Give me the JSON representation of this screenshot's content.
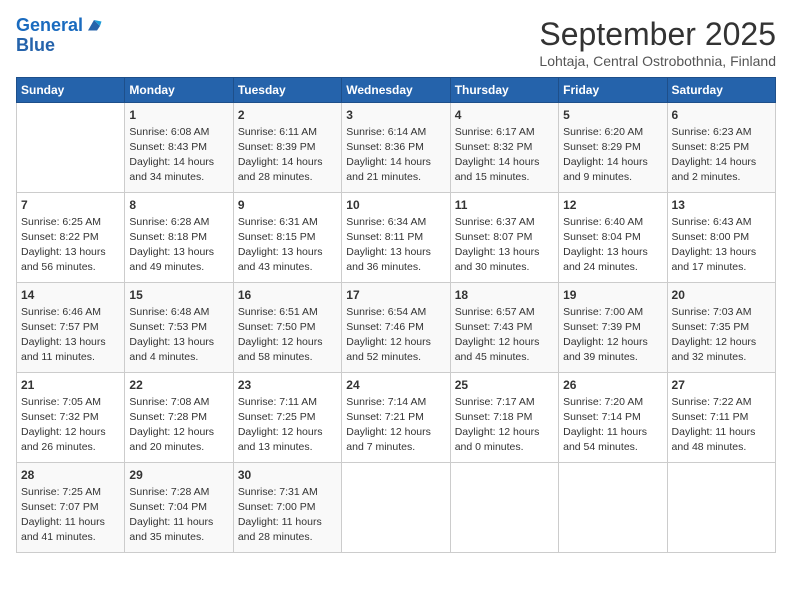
{
  "logo": {
    "line1": "General",
    "line2": "Blue"
  },
  "title": "September 2025",
  "location": "Lohtaja, Central Ostrobothnia, Finland",
  "days_of_week": [
    "Sunday",
    "Monday",
    "Tuesday",
    "Wednesday",
    "Thursday",
    "Friday",
    "Saturday"
  ],
  "weeks": [
    [
      {
        "day": "",
        "info": ""
      },
      {
        "day": "1",
        "info": "Sunrise: 6:08 AM\nSunset: 8:43 PM\nDaylight: 14 hours\nand 34 minutes."
      },
      {
        "day": "2",
        "info": "Sunrise: 6:11 AM\nSunset: 8:39 PM\nDaylight: 14 hours\nand 28 minutes."
      },
      {
        "day": "3",
        "info": "Sunrise: 6:14 AM\nSunset: 8:36 PM\nDaylight: 14 hours\nand 21 minutes."
      },
      {
        "day": "4",
        "info": "Sunrise: 6:17 AM\nSunset: 8:32 PM\nDaylight: 14 hours\nand 15 minutes."
      },
      {
        "day": "5",
        "info": "Sunrise: 6:20 AM\nSunset: 8:29 PM\nDaylight: 14 hours\nand 9 minutes."
      },
      {
        "day": "6",
        "info": "Sunrise: 6:23 AM\nSunset: 8:25 PM\nDaylight: 14 hours\nand 2 minutes."
      }
    ],
    [
      {
        "day": "7",
        "info": "Sunrise: 6:25 AM\nSunset: 8:22 PM\nDaylight: 13 hours\nand 56 minutes."
      },
      {
        "day": "8",
        "info": "Sunrise: 6:28 AM\nSunset: 8:18 PM\nDaylight: 13 hours\nand 49 minutes."
      },
      {
        "day": "9",
        "info": "Sunrise: 6:31 AM\nSunset: 8:15 PM\nDaylight: 13 hours\nand 43 minutes."
      },
      {
        "day": "10",
        "info": "Sunrise: 6:34 AM\nSunset: 8:11 PM\nDaylight: 13 hours\nand 36 minutes."
      },
      {
        "day": "11",
        "info": "Sunrise: 6:37 AM\nSunset: 8:07 PM\nDaylight: 13 hours\nand 30 minutes."
      },
      {
        "day": "12",
        "info": "Sunrise: 6:40 AM\nSunset: 8:04 PM\nDaylight: 13 hours\nand 24 minutes."
      },
      {
        "day": "13",
        "info": "Sunrise: 6:43 AM\nSunset: 8:00 PM\nDaylight: 13 hours\nand 17 minutes."
      }
    ],
    [
      {
        "day": "14",
        "info": "Sunrise: 6:46 AM\nSunset: 7:57 PM\nDaylight: 13 hours\nand 11 minutes."
      },
      {
        "day": "15",
        "info": "Sunrise: 6:48 AM\nSunset: 7:53 PM\nDaylight: 13 hours\nand 4 minutes."
      },
      {
        "day": "16",
        "info": "Sunrise: 6:51 AM\nSunset: 7:50 PM\nDaylight: 12 hours\nand 58 minutes."
      },
      {
        "day": "17",
        "info": "Sunrise: 6:54 AM\nSunset: 7:46 PM\nDaylight: 12 hours\nand 52 minutes."
      },
      {
        "day": "18",
        "info": "Sunrise: 6:57 AM\nSunset: 7:43 PM\nDaylight: 12 hours\nand 45 minutes."
      },
      {
        "day": "19",
        "info": "Sunrise: 7:00 AM\nSunset: 7:39 PM\nDaylight: 12 hours\nand 39 minutes."
      },
      {
        "day": "20",
        "info": "Sunrise: 7:03 AM\nSunset: 7:35 PM\nDaylight: 12 hours\nand 32 minutes."
      }
    ],
    [
      {
        "day": "21",
        "info": "Sunrise: 7:05 AM\nSunset: 7:32 PM\nDaylight: 12 hours\nand 26 minutes."
      },
      {
        "day": "22",
        "info": "Sunrise: 7:08 AM\nSunset: 7:28 PM\nDaylight: 12 hours\nand 20 minutes."
      },
      {
        "day": "23",
        "info": "Sunrise: 7:11 AM\nSunset: 7:25 PM\nDaylight: 12 hours\nand 13 minutes."
      },
      {
        "day": "24",
        "info": "Sunrise: 7:14 AM\nSunset: 7:21 PM\nDaylight: 12 hours\nand 7 minutes."
      },
      {
        "day": "25",
        "info": "Sunrise: 7:17 AM\nSunset: 7:18 PM\nDaylight: 12 hours\nand 0 minutes."
      },
      {
        "day": "26",
        "info": "Sunrise: 7:20 AM\nSunset: 7:14 PM\nDaylight: 11 hours\nand 54 minutes."
      },
      {
        "day": "27",
        "info": "Sunrise: 7:22 AM\nSunset: 7:11 PM\nDaylight: 11 hours\nand 48 minutes."
      }
    ],
    [
      {
        "day": "28",
        "info": "Sunrise: 7:25 AM\nSunset: 7:07 PM\nDaylight: 11 hours\nand 41 minutes."
      },
      {
        "day": "29",
        "info": "Sunrise: 7:28 AM\nSunset: 7:04 PM\nDaylight: 11 hours\nand 35 minutes."
      },
      {
        "day": "30",
        "info": "Sunrise: 7:31 AM\nSunset: 7:00 PM\nDaylight: 11 hours\nand 28 minutes."
      },
      {
        "day": "",
        "info": ""
      },
      {
        "day": "",
        "info": ""
      },
      {
        "day": "",
        "info": ""
      },
      {
        "day": "",
        "info": ""
      }
    ]
  ]
}
